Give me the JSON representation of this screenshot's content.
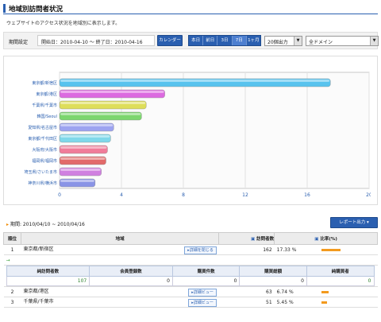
{
  "page": {
    "title": "地域別訪問者状況",
    "description": "ウェブサイトのアクセス状況を地域別に表示します。"
  },
  "filter": {
    "period_label": "期間設定",
    "range_text": "開始日：2010-04-10 ～ 終了日：2010-04-16",
    "calendar_button": "カレンダー",
    "period_buttons": [
      "本日",
      "前日",
      "3日",
      "7日",
      "1ヶ月"
    ],
    "count_select": "20個出力",
    "domain_select": "全ドメイン"
  },
  "chart_data": {
    "type": "bar",
    "orientation": "horizontal",
    "categories": [
      "東京都/新宿区",
      "東京都/港区",
      "千葉県/千葉市",
      "韓国/Seoul",
      "愛知県/名古屋市",
      "東京都/千代田区",
      "大阪府/大阪市",
      "福岡県/福岡市",
      "埼玉県/さいたま市",
      "神奈川県/横浜市"
    ],
    "values": [
      17.5,
      6.8,
      5.6,
      5.3,
      3.5,
      3.3,
      3.1,
      3.0,
      2.7,
      2.3
    ],
    "xlim": [
      0,
      20
    ],
    "xticks": [
      "0",
      "4",
      "8",
      "12",
      "16",
      "20"
    ],
    "colors": [
      "#58c3ee",
      "#dc6ae0",
      "#dede5a",
      "#7cd66e",
      "#9da3f0",
      "#7fd8ea",
      "#f07c9a",
      "#e26a6a",
      "#d080e0",
      "#8a94e6"
    ],
    "grid": true
  },
  "summary": {
    "period_text": "期間: 2010/04/10 ~ 2010/04/16",
    "report_button": "レポート出力"
  },
  "table": {
    "headers": {
      "rank": "順位",
      "region": "地域",
      "visits": "訪問者数",
      "ratio": "比率(%)"
    },
    "detail_open_label": "詳細を閉じる",
    "detail_label": "詳細ビュー",
    "rows": [
      {
        "rank": "1",
        "region": "東京都/新宿区",
        "visits": "162",
        "ratio": "17.33 %",
        "ratio_value": 17.33
      },
      {
        "rank": "2",
        "region": "東京都/港区",
        "visits": "63",
        "ratio": "6.74 %",
        "ratio_value": 6.74
      },
      {
        "rank": "3",
        "region": "千葉県/千葉市",
        "visits": "51",
        "ratio": "5.45 %",
        "ratio_value": 5.45
      }
    ],
    "sub": {
      "headers": [
        "純訪問者数",
        "会員登録数",
        "購買件数",
        "購買総額",
        "純購買者"
      ],
      "values": [
        "107",
        "0",
        "0",
        "0",
        "0"
      ]
    }
  }
}
